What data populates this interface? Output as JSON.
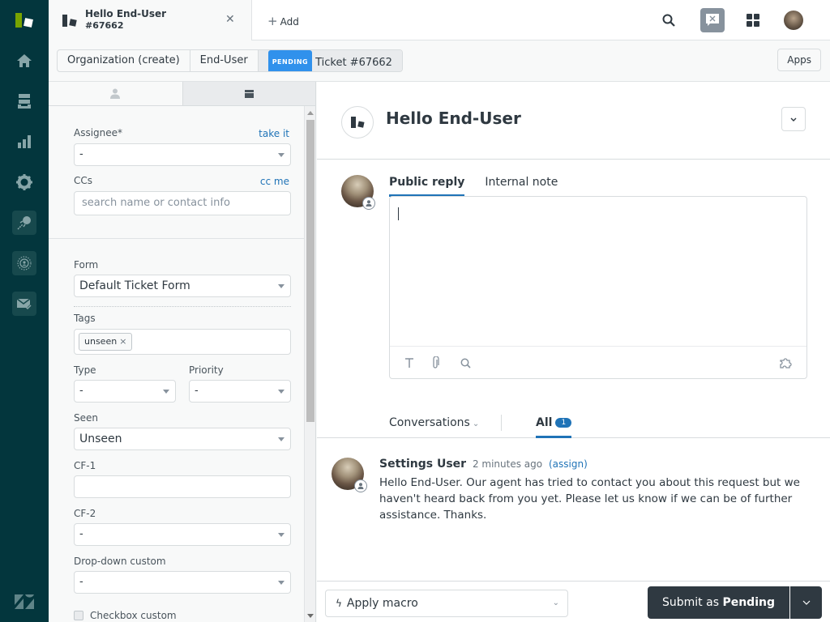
{
  "nav": {
    "items": [
      {
        "name": "home",
        "icon": "home-icon"
      },
      {
        "name": "views",
        "icon": "views-icon"
      },
      {
        "name": "reporting",
        "icon": "bar-chart-icon"
      },
      {
        "name": "admin",
        "icon": "gear-icon"
      },
      {
        "name": "explore",
        "icon": "explore-icon"
      },
      {
        "name": "guide",
        "icon": "radar-icon"
      },
      {
        "name": "email",
        "icon": "mail-check-icon"
      }
    ]
  },
  "topbar": {
    "tab_title": "Hello End-User",
    "tab_number": "#67662",
    "add_label": "Add"
  },
  "breadcrumb": {
    "items": [
      "Organization (create)",
      "End-User"
    ],
    "status_badge": "PENDING",
    "ticket_label": "Ticket #67662",
    "apps_label": "Apps"
  },
  "props": {
    "assignee_label": "Assignee*",
    "assignee_link": "take it",
    "assignee_value": "-",
    "ccs_label": "CCs",
    "ccs_link": "cc me",
    "ccs_placeholder": "search name or contact info",
    "form_label": "Form",
    "form_value": "Default Ticket Form",
    "tags_label": "Tags",
    "tags": [
      "unseen"
    ],
    "type_label": "Type",
    "type_value": "-",
    "priority_label": "Priority",
    "priority_value": "-",
    "seen_label": "Seen",
    "seen_value": "Unseen",
    "cf1_label": "CF-1",
    "cf1_value": "",
    "cf2_label": "CF-2",
    "cf2_value": "-",
    "dropdown_label": "Drop-down custom",
    "dropdown_value": "-",
    "checkbox_label": "Checkbox custom"
  },
  "main": {
    "title": "Hello End-User",
    "reply_tabs": [
      "Public reply",
      "Internal note"
    ],
    "conversations_label": "Conversations",
    "all_label": "All",
    "all_count": "1",
    "message": {
      "author": "Settings User",
      "time": "2 minutes ago",
      "assign": "(assign)",
      "body": "Hello End-User. Our agent has tried to contact you about this request but we haven't heard back from you yet. Please let us know if we can be of further assistance. Thanks."
    },
    "macro_label": "Apply macro",
    "submit_prefix": "Submit as",
    "submit_status": "Pending"
  },
  "colors": {
    "nav_bg": "#03363d",
    "accent": "#1f73b7",
    "pending_badge": "#3091ec",
    "submit_bg": "#2f3941"
  }
}
